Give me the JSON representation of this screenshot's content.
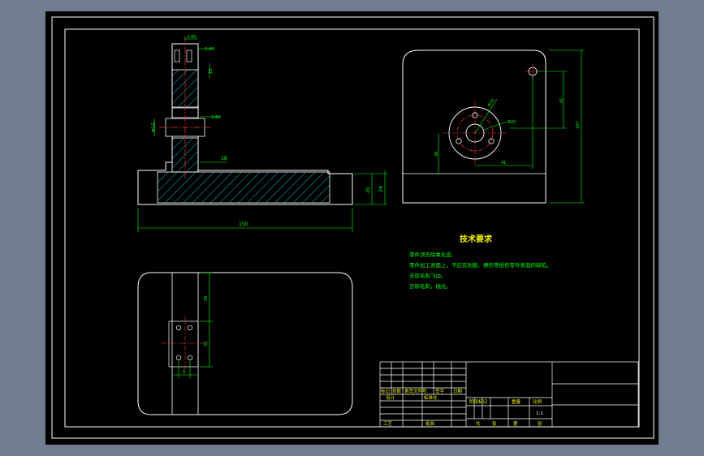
{
  "colors": {
    "outer_background": "#6f7d8f",
    "canvas": "#000000",
    "outline": "#ffffff",
    "dimension": "#00ff00",
    "centerline": "#ff3030",
    "hatch": "#00bcd4",
    "text_yellow": "#f2f200"
  },
  "front_view": {
    "dim_top_holes": "2-Φ5",
    "dim_slot": "2-Φ5",
    "dim_side_holes": "3-Φ4",
    "dim_bore": "Φ15",
    "dim_step": "15",
    "dim_length": "150",
    "dim_base_h1": "20",
    "dim_base_h2": "24",
    "dim_stem": "18"
  },
  "side_view": {
    "dim_bolt_circle": "Φ30",
    "dim_bore": "Φ20",
    "dim_h_offset": "41",
    "dim_v_offset": "41",
    "dim_height": "107",
    "dim_left": "30"
  },
  "top_view": {
    "dim_upper": "35",
    "dim_mid": "25",
    "dim_low": "5"
  },
  "tech_notes": {
    "title": "技术要求",
    "lines": [
      "零件须去除氧化皮。",
      "零件加工表面上，不应有划痕、擦伤等损伤零件表面的缺陷。",
      "去除毛刺飞边。",
      "去除毛刺，抛光。"
    ]
  },
  "title_block": {
    "row_labels": [
      "标记",
      "处数",
      "更改文件号",
      "签字",
      "日期"
    ],
    "design_label": "设计",
    "standard_label": "标准化",
    "stage_labels": [
      "阶段标记",
      "重量",
      "比例"
    ],
    "scale": "1:1",
    "craft_label": "工艺",
    "approve_label": "批准",
    "sheet_labels": [
      "共",
      "张",
      "第",
      "张"
    ]
  }
}
